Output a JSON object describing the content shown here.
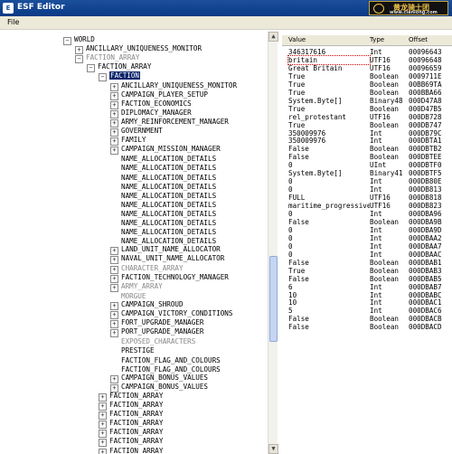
{
  "window": {
    "title": "ESF Editor",
    "icon": "app-icon"
  },
  "watermark": {
    "line1": "黄龙骑士团",
    "line2": "www.clanlong.com"
  },
  "menu": {
    "file": "File"
  },
  "tree": [
    {
      "label": "WORLD",
      "level": 0,
      "toggle": "minus"
    },
    {
      "label": "ANCILLARY_UNIQUENESS_MONITOR",
      "level": 1,
      "toggle": "plus"
    },
    {
      "label": "FACTION_ARRAY",
      "level": 1,
      "toggle": "minus",
      "gray": true
    },
    {
      "label": "FACTION_ARRAY",
      "level": 2,
      "toggle": "minus"
    },
    {
      "label": "FACTION",
      "level": 3,
      "toggle": "minus",
      "selected": true
    },
    {
      "label": "ANCILLARY_UNIQUENESS_MONITOR",
      "level": 4,
      "toggle": "plus"
    },
    {
      "label": "CAMPAIGN_PLAYER_SETUP",
      "level": 4,
      "toggle": "plus"
    },
    {
      "label": "FACTION_ECONOMICS",
      "level": 4,
      "toggle": "plus"
    },
    {
      "label": "DIPLOMACY_MANAGER",
      "level": 4,
      "toggle": "plus"
    },
    {
      "label": "ARMY_REINFORCEMENT_MANAGER",
      "level": 4,
      "toggle": "plus"
    },
    {
      "label": "GOVERNMENT",
      "level": 4,
      "toggle": "plus"
    },
    {
      "label": "FAMILY",
      "level": 4,
      "toggle": "plus"
    },
    {
      "label": "CAMPAIGN_MISSION_MANAGER",
      "level": 4,
      "toggle": "plus"
    },
    {
      "label": "NAME_ALLOCATION_DETAILS",
      "level": 4,
      "toggle": "none"
    },
    {
      "label": "NAME_ALLOCATION_DETAILS",
      "level": 4,
      "toggle": "none"
    },
    {
      "label": "NAME_ALLOCATION_DETAILS",
      "level": 4,
      "toggle": "none"
    },
    {
      "label": "NAME_ALLOCATION_DETAILS",
      "level": 4,
      "toggle": "none"
    },
    {
      "label": "NAME_ALLOCATION_DETAILS",
      "level": 4,
      "toggle": "none"
    },
    {
      "label": "NAME_ALLOCATION_DETAILS",
      "level": 4,
      "toggle": "none"
    },
    {
      "label": "NAME_ALLOCATION_DETAILS",
      "level": 4,
      "toggle": "none"
    },
    {
      "label": "NAME_ALLOCATION_DETAILS",
      "level": 4,
      "toggle": "none"
    },
    {
      "label": "NAME_ALLOCATION_DETAILS",
      "level": 4,
      "toggle": "none"
    },
    {
      "label": "NAME_ALLOCATION_DETAILS",
      "level": 4,
      "toggle": "none"
    },
    {
      "label": "LAND_UNIT_NAME_ALLOCATOR",
      "level": 4,
      "toggle": "plus"
    },
    {
      "label": "NAVAL_UNIT_NAME_ALLOCATOR",
      "level": 4,
      "toggle": "plus"
    },
    {
      "label": "CHARACTER_ARRAY",
      "level": 4,
      "toggle": "plus",
      "gray": true
    },
    {
      "label": "FACTION_TECHNOLOGY_MANAGER",
      "level": 4,
      "toggle": "plus"
    },
    {
      "label": "ARMY_ARRAY",
      "level": 4,
      "toggle": "plus",
      "gray": true
    },
    {
      "label": "MORGUE",
      "level": 4,
      "toggle": "none",
      "gray": true
    },
    {
      "label": "CAMPAIGN_SHROUD",
      "level": 4,
      "toggle": "plus"
    },
    {
      "label": "CAMPAIGN_VICTORY_CONDITIONS",
      "level": 4,
      "toggle": "plus"
    },
    {
      "label": "FORT_UPGRADE_MANAGER",
      "level": 4,
      "toggle": "plus"
    },
    {
      "label": "PORT_UPGRADE_MANAGER",
      "level": 4,
      "toggle": "plus"
    },
    {
      "label": "EXPOSED_CHARACTERS",
      "level": 4,
      "toggle": "none",
      "gray": true
    },
    {
      "label": "PRESTIGE",
      "level": 4,
      "toggle": "none"
    },
    {
      "label": "FACTION_FLAG_AND_COLOURS",
      "level": 4,
      "toggle": "none"
    },
    {
      "label": "FACTION_FLAG_AND_COLOURS",
      "level": 4,
      "toggle": "none"
    },
    {
      "label": "CAMPAIGN_BONUS_VALUES",
      "level": 4,
      "toggle": "plus"
    },
    {
      "label": "CAMPAIGN_BONUS_VALUES",
      "level": 4,
      "toggle": "plus"
    },
    {
      "label": "FACTION_ARRAY",
      "level": 3,
      "toggle": "plus"
    },
    {
      "label": "FACTION_ARRAY",
      "level": 3,
      "toggle": "plus"
    },
    {
      "label": "FACTION_ARRAY",
      "level": 3,
      "toggle": "plus"
    },
    {
      "label": "FACTION_ARRAY",
      "level": 3,
      "toggle": "plus"
    },
    {
      "label": "FACTION_ARRAY",
      "level": 3,
      "toggle": "plus"
    },
    {
      "label": "FACTION_ARRAY",
      "level": 3,
      "toggle": "plus"
    },
    {
      "label": "FACTION_ARRAY",
      "level": 3,
      "toggle": "plus"
    },
    {
      "label": "FACTION_ARRAY",
      "level": 3,
      "toggle": "plus"
    }
  ],
  "grid": {
    "columns": [
      "Value",
      "Type",
      "Offset"
    ],
    "rows": [
      [
        "346317616",
        "Int",
        "00096643"
      ],
      [
        "britain",
        "UTF16",
        "00096648"
      ],
      [
        "Great Britain",
        "UTF16",
        "00096659"
      ],
      [
        "True",
        "Boolean",
        "0009711E"
      ],
      [
        "True",
        "Boolean",
        "00BB69TA"
      ],
      [
        "True",
        "Boolean",
        "000BBA66"
      ],
      [
        "System.Byte[]",
        "Binary48",
        "000D47A8"
      ],
      [
        "True",
        "Boolean",
        "000D47B5"
      ],
      [
        "rel_protestant",
        "UTF16",
        "000DB728"
      ],
      [
        "True",
        "Boolean",
        "000DB747"
      ],
      [
        "350009976",
        "Int",
        "000DB79C"
      ],
      [
        "350009976",
        "Int",
        "000DBTA1"
      ],
      [
        "False",
        "Boolean",
        "000DBTB2"
      ],
      [
        "False",
        "Boolean",
        "000DBTEE"
      ],
      [
        "0",
        "UInt",
        "000DBTF0"
      ],
      [
        "System.Byte[]",
        "Binary41",
        "000DBTF5"
      ],
      [
        "0",
        "Int",
        "000DB80E"
      ],
      [
        "0",
        "Int",
        "000DB813"
      ],
      [
        "FULL",
        "UTF16",
        "000DB818"
      ],
      [
        "maritime_progressive",
        "UTF16",
        "000DB823"
      ],
      [
        "0",
        "Int",
        "000DBA96"
      ],
      [
        "False",
        "Boolean",
        "000DBA9B"
      ],
      [
        "0",
        "Int",
        "000DBA9D"
      ],
      [
        "0",
        "Int",
        "000DBAA2"
      ],
      [
        "0",
        "Int",
        "000DBAA7"
      ],
      [
        "0",
        "Int",
        "000DBAAC"
      ],
      [
        "False",
        "Boolean",
        "000DBAB1"
      ],
      [
        "True",
        "Boolean",
        "000DBAB3"
      ],
      [
        "False",
        "Boolean",
        "000DBAB5"
      ],
      [
        "6",
        "Int",
        "000DBAB7"
      ],
      [
        "10",
        "Int",
        "000DBABC"
      ],
      [
        "10",
        "Int",
        "000DBAC1"
      ],
      [
        "5",
        "Int",
        "000DBAC6"
      ],
      [
        "False",
        "Boolean",
        "000DBACB"
      ],
      [
        "False",
        "Boolean",
        "000DBACD"
      ]
    ]
  }
}
